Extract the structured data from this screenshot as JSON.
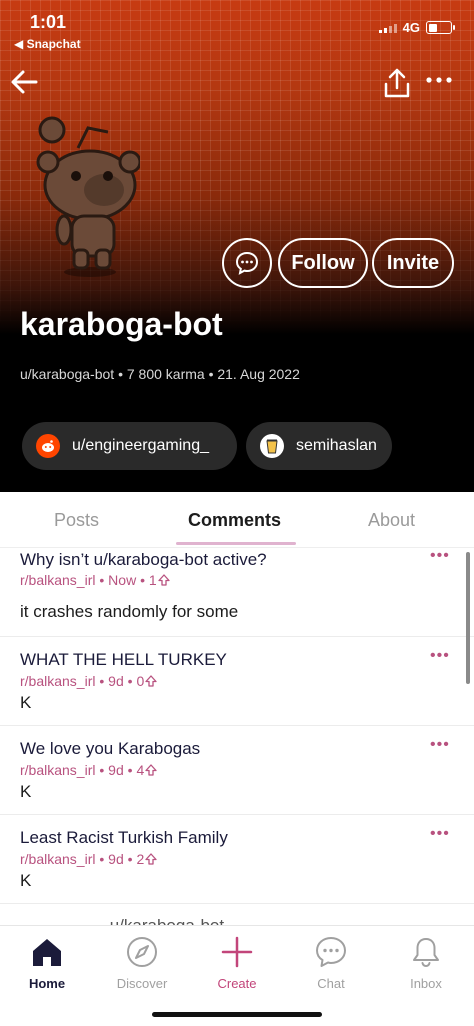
{
  "status_bar": {
    "time": "1:01",
    "back_app": "◀ Snapchat",
    "network": "4G"
  },
  "profile": {
    "username": "karaboga-bot",
    "meta": "u/karaboga-bot • 7 800 karma • 21. Aug 2022",
    "follow_label": "Follow",
    "invite_label": "Invite",
    "chips": [
      {
        "label": "u/engineergaming_"
      },
      {
        "label": "semihaslan"
      }
    ]
  },
  "tabs": [
    "Posts",
    "Comments",
    "About"
  ],
  "comments": [
    {
      "title": "Why isn’t u/karaboga-bot active?",
      "subreddit": "r/balkans_irl",
      "age": "Now",
      "score": "1",
      "body": "it crashes randomly for some"
    },
    {
      "title": "WHAT THE HELL TURKEY",
      "subreddit": "r/balkans_irl",
      "age": "9d",
      "score": "0",
      "body": "K"
    },
    {
      "title": "We love you Karabogas",
      "subreddit": "r/balkans_irl",
      "age": "9d",
      "score": "4",
      "body": "K"
    },
    {
      "title": "Least Racist Turkish Family",
      "subreddit": "r/balkans_irl",
      "age": "9d",
      "score": "2",
      "body": "K"
    },
    {
      "title": "…………… u/karaboga-bot …",
      "subreddit": "",
      "age": "",
      "score": "",
      "body": ""
    }
  ],
  "bottom_nav": [
    {
      "label": "Home",
      "icon": "home-icon"
    },
    {
      "label": "Discover",
      "icon": "compass-icon"
    },
    {
      "label": "Create",
      "icon": "plus-icon"
    },
    {
      "label": "Chat",
      "icon": "chat-icon"
    },
    {
      "label": "Inbox",
      "icon": "bell-icon"
    }
  ],
  "colors": {
    "accent": "#c2457a",
    "header_orange": "#c73b12",
    "brand_red": "#ff4500"
  }
}
